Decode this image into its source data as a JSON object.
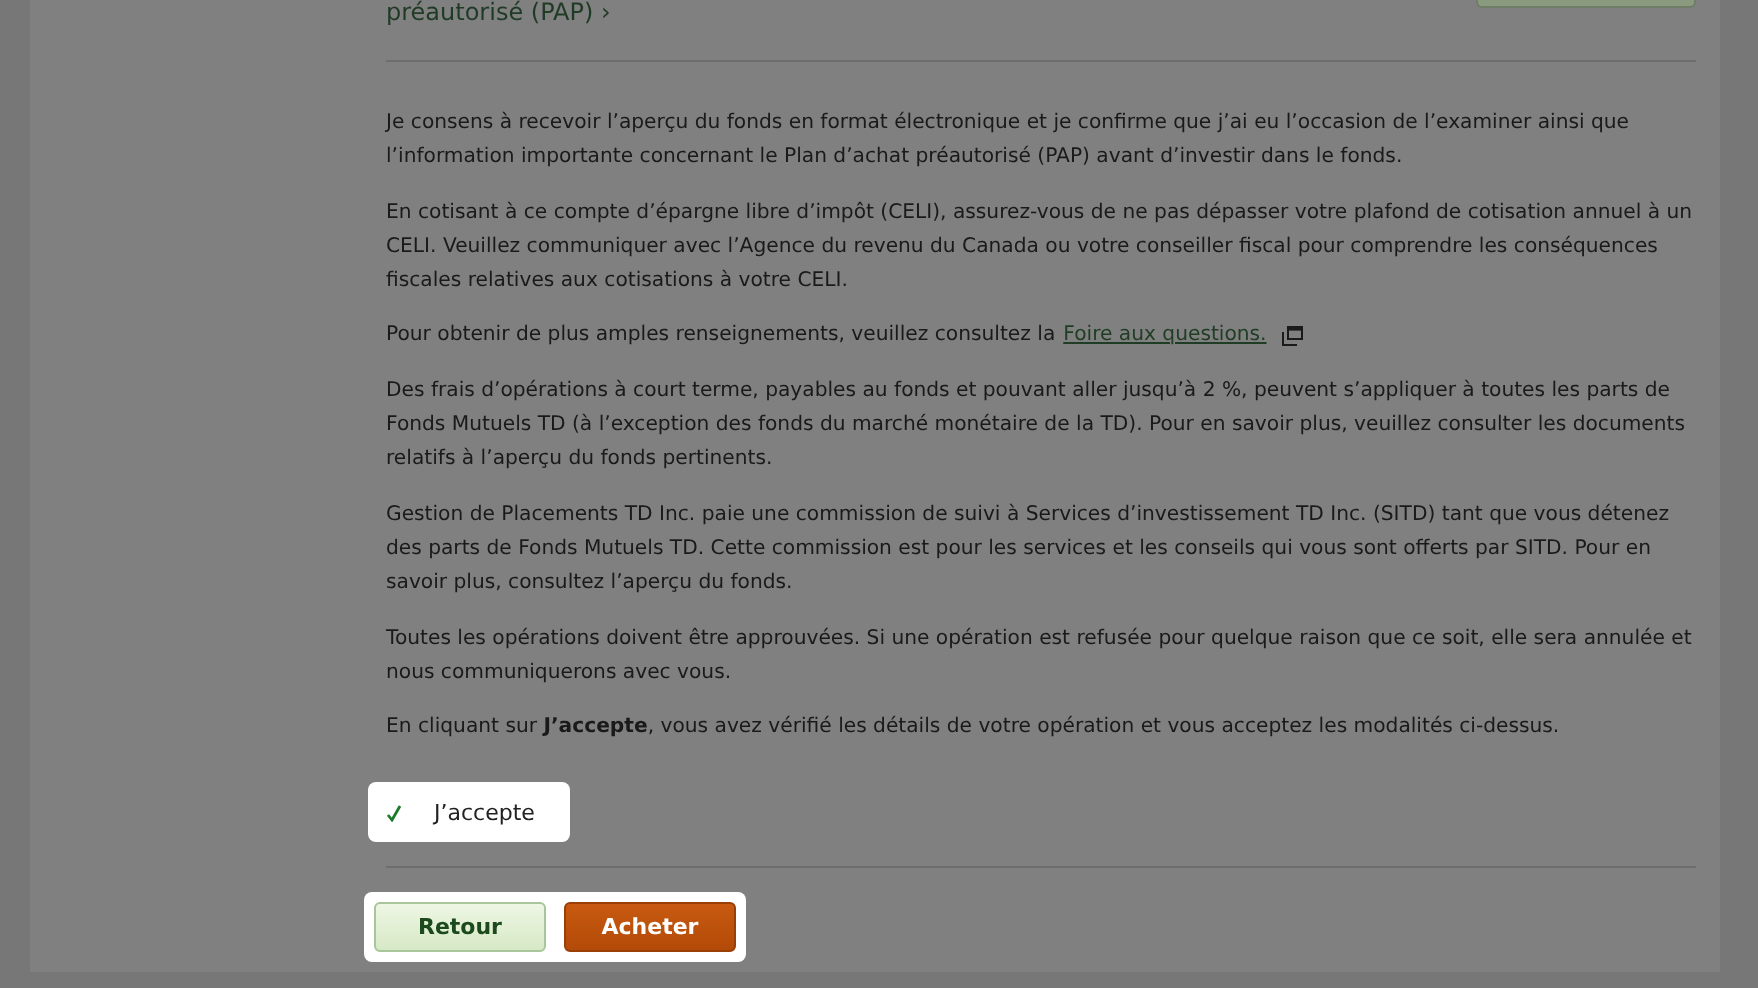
{
  "header_link": "préautorisé (PAP) ›",
  "paragraphs": [
    "Je consens à recevoir l’aperçu du fonds en format électronique et je confirme que j’ai eu l’occasion de l’examiner ainsi que l’information importante concernant le Plan d’achat préautorisé (PAP) avant d’investir dans le fonds.",
    "En cotisant à ce compte d’épargne libre d’impôt (CELI), assurez-vous de ne pas dépasser votre plafond de cotisation annuel à un CELI. Veuillez communiquer avec l’Agence du revenu du Canada ou votre conseiller fiscal pour comprendre les conséquences fiscales relatives aux cotisations à votre CELI."
  ],
  "faq": {
    "text": "Pour obtenir de plus amples renseignements, veuillez consultez la",
    "link": "Foire aux questions."
  },
  "paragraphs_after": [
    "Des frais d’opérations à court terme, payables au fonds et pouvant aller jusqu’à 2 %, peuvent s’appliquer à toutes les parts de Fonds Mutuels TD (à l’exception des fonds du marché monétaire de la TD). Pour en savoir plus, veuillez consulter les documents relatifs à l’aperçu du fonds pertinents.",
    "Gestion de Placements TD Inc. paie une commission de suivi à Services d’investissement TD Inc. (SITD) tant que vous détenez des parts de Fonds Mutuels TD. Cette commission est pour les services et les conseils qui vous sont offerts par SITD. Pour en savoir plus, consultez l’aperçu du fonds.",
    "Toutes les opérations doivent être approuvées. Si une opération est refusée pour quelque raison que ce soit, elle sera annulée et nous communiquerons avec vous.",
    "En cliquant sur **J’accepte**, vous avez vérifié les détails de votre opération et vous acceptez les modalités ci-dessus."
  ],
  "agree": {
    "label": "J’accepte",
    "checked": true
  },
  "buttons": [
    {
      "label": "Retour",
      "kind": "secondary"
    },
    {
      "label": "Acheter",
      "kind": "primary"
    }
  ]
}
